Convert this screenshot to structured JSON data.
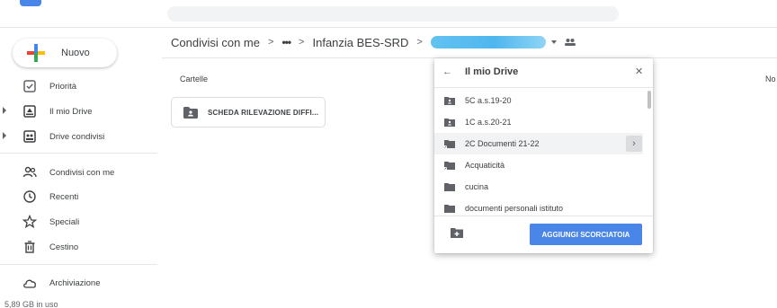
{
  "sidebar": {
    "new_label": "Nuovo",
    "items": [
      {
        "label": "Priorità"
      },
      {
        "label": "Il mio Drive"
      },
      {
        "label": "Drive condivisi"
      },
      {
        "label": "Condivisi con me"
      },
      {
        "label": "Recenti"
      },
      {
        "label": "Speciali"
      },
      {
        "label": "Cestino"
      },
      {
        "label": "Archiviazione"
      }
    ],
    "storage_text": "5,89 GB in uso"
  },
  "breadcrumb": {
    "root": "Condivisi con me",
    "more": "•••",
    "folder": "Infanzia BES-SRD"
  },
  "main": {
    "section_title": "Cartelle",
    "right_column_partial": "No",
    "folder_name": "SCHEDA RILEVAZIONE DIFFI..."
  },
  "dialog": {
    "title": "Il mio Drive",
    "items": [
      {
        "label": "5C a.s.19-20",
        "icon": "shared-folder-icon"
      },
      {
        "label": "1C a.s.20-21",
        "icon": "shared-folder-icon"
      },
      {
        "label": "2C Documenti 21-22",
        "icon": "shortcut-folder-icon"
      },
      {
        "label": "Acquaticità",
        "icon": "shortcut-folder-icon"
      },
      {
        "label": "cucina",
        "icon": "folder-icon"
      },
      {
        "label": "documenti personali istituto",
        "icon": "folder-icon"
      }
    ],
    "add_button": "AGGIUNGI SCORCIATOIA"
  },
  "colors": {
    "accent": "#4a86e8",
    "redaction": "#4fb6ee"
  }
}
